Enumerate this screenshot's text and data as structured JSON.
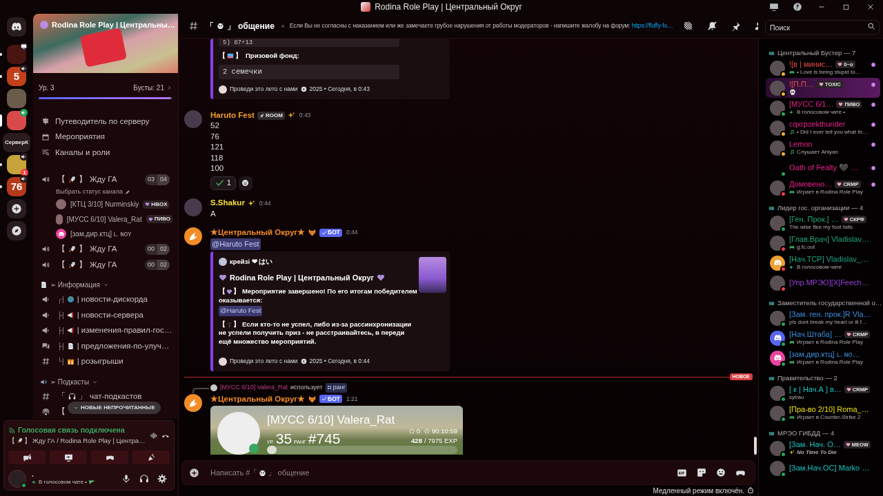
{
  "window": {
    "title": "Rodina Role Play | Центральный Округ"
  },
  "servers": [
    {
      "kind": "home",
      "selected": false,
      "unread": false
    },
    {
      "kind": "server",
      "selected": false,
      "unread": true,
      "activity": {
        "kind": "screen"
      }
    },
    {
      "kind": "server",
      "selected": false,
      "unread": true,
      "activity": {
        "kind": "speaker"
      },
      "label": "5"
    },
    {
      "kind": "server",
      "selected": false,
      "unread": false
    },
    {
      "kind": "server",
      "selected": true,
      "unread": false,
      "activity": {
        "kind": "speaker_active"
      }
    },
    {
      "kind": "server",
      "selected": false,
      "unread": false,
      "label": "СерверК"
    },
    {
      "kind": "server",
      "selected": false,
      "unread": true,
      "activity": {
        "kind": "speaker"
      },
      "mentions": "1"
    },
    {
      "kind": "server",
      "selected": false,
      "unread": true,
      "activity": {
        "kind": "speaker"
      },
      "label": "76"
    },
    {
      "kind": "add",
      "selected": false,
      "unread": false
    },
    {
      "kind": "explore",
      "selected": false,
      "unread": false
    }
  ],
  "sidebar": {
    "server_name": "Rodina Role Play | Центральны…",
    "boost": {
      "tier": "Ур. 3",
      "boosts": "Бусты: 21",
      "level": 0.99
    },
    "nav": [
      {
        "kind": "guide",
        "label": "Путеводитель по серверу"
      },
      {
        "kind": "events",
        "label": "Мероприятия"
      },
      {
        "kind": "browse",
        "label": "Каналы и роли"
      }
    ],
    "channels": [
      {
        "kind": "voice",
        "open": "【",
        "close": "】",
        "name": "Жду ГА",
        "counts": [
          "03",
          "04"
        ],
        "status": "Выбрать статус канала",
        "users": [
          {
            "name": "[КТЦ 3/10] Nurminskiy",
            "tag": "HBOX"
          },
          {
            "name": "[МУСС 6/10] Valera_Rat",
            "tag": "ПИВО"
          },
          {
            "name": "[зам.дир.ктц] ʟ. ɴᴏʏ"
          }
        ]
      },
      {
        "kind": "voice",
        "open": "【",
        "close": "】",
        "name": "Жду ГА",
        "counts": [
          "00",
          "02"
        ]
      },
      {
        "kind": "voice",
        "open": "【",
        "close": "】",
        "name": "Жду ГА",
        "counts": [
          "00",
          "02"
        ]
      },
      {
        "kind": "category",
        "name": "➢ Информация"
      },
      {
        "kind": "announcement",
        "tree": "┌|",
        "name": "| новости-дискорда"
      },
      {
        "kind": "announcement",
        "tree": "├|",
        "name": "| новости-сервера"
      },
      {
        "kind": "announcement",
        "tree": "├|",
        "name": "| изменения-правил-гос…"
      },
      {
        "kind": "forum",
        "tree": "├|",
        "name": "| предложения-по-улуч…"
      },
      {
        "kind": "text",
        "tree": "└|",
        "name": "| розыгрыши"
      },
      {
        "kind": "category",
        "name": "➢ Подкасты"
      },
      {
        "kind": "text",
        "open": "「",
        "close": "」",
        "name": "чат-подкастов"
      },
      {
        "kind": "stage",
        "open": "【"
      }
    ],
    "new_unread": "НОВЫЕ НЕПРОЧИТАННЫЕ",
    "voice_panel": {
      "status": "Голосовая связь подключена",
      "open": "【",
      "close": "】",
      "location": "Жду ГА / Rodina Role Play | Центра…"
    },
    "user": {
      "name": ".",
      "status": "В голосовом чате •"
    }
  },
  "chat": {
    "header": {
      "open": "「",
      "close": "」",
      "channel": "общение",
      "topic": "Если Вы не согласны с наказанием или же замечаете грубое нарушения от работы модераторов - напишите жалобу на форум:",
      "link": "https://fluffy-fo…"
    },
    "messages": [
      {
        "kind": "embed_tail",
        "code_top": "5) 87+13",
        "field_open": "【",
        "field_close": "】",
        "field": "Призовой фонд:",
        "code": "2 семечки",
        "footer": "Проведи это лето с нами",
        "footer_time": "2025 • Сегодня, в 0:43"
      },
      {
        "kind": "message",
        "author": "Haruto Fest",
        "color": "#f0a030",
        "tag": "ROOM",
        "time": "0:43",
        "lines": [
          "52",
          "76",
          "121",
          "118",
          "100"
        ],
        "reaction": {
          "count": "1",
          "selected": false
        }
      },
      {
        "kind": "message",
        "author": "S.Shakur",
        "color": "#f3e03b",
        "time": "0:44",
        "lines": [
          "A"
        ]
      },
      {
        "kind": "bot_embed",
        "author": "★Центральный Округ★",
        "color": "#f28c28",
        "bot": "БОТ",
        "time": "0:44",
        "mention": "@Haruto Fest",
        "embed": {
          "author": "крейзі ❤ はい",
          "title": "Rodina Role Play | Центральный Округ",
          "paragraphs": [
            {
              "open": "【",
              "close": "】",
              "text": "Мероприятие завершено! По его итогам победителем оказывается:",
              "mention": "@Haruto Fest"
            },
            {
              "open": "【",
              "close": "】",
              "text": "Если кто-то не успел, либо из-за рассинхронизации не успели получить приз - не расстраивайтесь, в переди ещё множество мероприятий."
            }
          ],
          "footer": "Проведи это лето с нами",
          "footer_time": "2025 • Сегодня, в 0:44"
        }
      },
      {
        "kind": "divider",
        "label": "НОВОЕ"
      },
      {
        "kind": "rank",
        "reply": {
          "user": "[МУСС 6/10] Valera_Rat",
          "verb": "использует",
          "command": "ранг"
        },
        "author": "★Центральный Округ★",
        "color": "#f28c28",
        "bot": "БОТ",
        "time": "1:21",
        "card": {
          "name": "[МУСС 6/10] Valera_Rat",
          "level_label": "УР.",
          "level_value": "35",
          "rank_label": "РАНГ",
          "rank": "#745",
          "coins": "0",
          "voice_time": "90:10:59",
          "xp": "428",
          "xp_total": "/ 7975 EXP",
          "level": 0.05
        }
      }
    ],
    "composer": {
      "placeholder": [
        "Написать #「",
        "」 общение"
      ]
    },
    "slow_mode": "Медленный режим включён."
  },
  "members": {
    "search": {
      "placeholder": "Поиск"
    },
    "groups": [
      {
        "title": "Центральный Бустер — 7",
        "members": [
          {
            "name": "![в | минис…",
            "color": "#ec4b4b",
            "tag": "0~o",
            "activity": {
              "kind": "game",
              "text": "•     Love is being stupid to…"
            },
            "presence": {
              "color": "#f0b232"
            },
            "avatar": {
              "kind": "photo"
            },
            "booster": true,
            "selected": false
          },
          {
            "name": "![П.П…",
            "color": "#ec4b4b",
            "tag": "TOXIC",
            "activity": {
              "kind": "skull"
            },
            "presence": {
              "color": "#f0b232"
            },
            "avatar": {
              "kind": "photo"
            },
            "booster": true,
            "selected": true
          },
          {
            "name": "[МУСС 6/1…",
            "color": "#e8208c",
            "tag": "ПИВО",
            "activity": {
              "kind": "voice",
              "text": "В голосовом чате •"
            },
            "presence": {
              "color": "#23a55a"
            },
            "avatar": {
              "kind": "photo"
            },
            "booster": true,
            "selected": false
          },
          {
            "name": "cqxrpsekthunder",
            "color": "#e8208c",
            "activity": {
              "kind": "music",
              "text": "• Did I ever tell you what th…"
            },
            "presence": {
              "color": "#f0b232"
            },
            "avatar": {
              "kind": "photo"
            },
            "booster": true,
            "selected": false
          },
          {
            "name": "Lemon",
            "color": "#e8208c",
            "activity": {
              "kind": "music",
              "text": "Слушает Ahiyan"
            },
            "presence": {
              "color": "#f0b232"
            },
            "avatar": {
              "kind": "photo"
            },
            "booster": true,
            "selected": false
          },
          {
            "name": "Oath of Fealty 🖤 …",
            "color": "#e8208c",
            "presence": {
              "color": "#23a55a"
            },
            "avatar": {
              "kind": "none"
            },
            "booster": true,
            "selected": false
          },
          {
            "name": "Домовено…",
            "color": "#e8208c",
            "tag": "CRMP",
            "activity": {
              "kind": "game",
              "text": "Играет в Rodina Role Play"
            },
            "presence": {
              "color": "#f23f43"
            },
            "avatar": {
              "kind": "photo"
            },
            "booster": true,
            "selected": false
          }
        ]
      },
      {
        "title": "Лидер гос. организации — 4",
        "members": [
          {
            "name": "[Ген. Прок.] …",
            "color": "#1fa784",
            "tag": "СКРФ",
            "activity": {
              "kind": "text",
              "text": "The wise flee my foot falls"
            },
            "presence": {
              "color": "#23a55a"
            },
            "avatar": {
              "kind": "photo"
            },
            "selected": false
          },
          {
            "name": "[Глав.Врач] Vladislav…",
            "color": "#1fa784",
            "activity": {
              "kind": "game",
              "text": "g.fc.out"
            },
            "presence": {
              "color": "#f23f43"
            },
            "avatar": {
              "kind": "photo"
            },
            "selected": false
          },
          {
            "name": "[Нач.ТСР] Vladislav_…",
            "color": "#1fa784",
            "activity": {
              "kind": "voice",
              "text": "В голосовом чате"
            },
            "presence": {
              "color": "#f23f43"
            },
            "avatar": {
              "kind": "discord",
              "color": "#f0a232"
            },
            "selected": false
          },
          {
            "name": "[Упр.МРЭО][X]Feech…",
            "color": "#9b3ddb",
            "presence": {
              "color": "#f23f43"
            },
            "avatar": {
              "kind": "photo"
            },
            "selected": false
          }
        ]
      },
      {
        "title": "Заместитель государственной о…",
        "members": [
          {
            "name": "[Зам. ген. прок.]R Vla…",
            "color": "#3d8fe0",
            "activity": {
              "kind": "text",
              "text": "pls dont break my heart or ill f…"
            },
            "presence": {
              "color": "#23a55a"
            },
            "avatar": {
              "kind": "photo"
            },
            "selected": false
          },
          {
            "name": "[Нач.Штаба] …",
            "color": "#3d8fe0",
            "tag": "CRMP",
            "activity": {
              "kind": "game",
              "text": "Играет в Rodina Role Play"
            },
            "presence": {
              "color": "#23a55a"
            },
            "avatar": {
              "kind": "discord",
              "color": "#5865f2"
            },
            "selected": false
          },
          {
            "name": "[зам.дир.ктц] ʟ. ɴᴏ…",
            "color": "#3d8fe0",
            "activity": {
              "kind": "game",
              "text": "Играет в Rodina Role Play"
            },
            "presence": {
              "color": "#23a55a"
            },
            "avatar": {
              "kind": "discord",
              "color": "#eb459e"
            },
            "selected": false
          }
        ]
      },
      {
        "title": "Правительство — 2",
        "members": [
          {
            "name": "[ к | Нач.А ] в…",
            "color": "#1cc3c3",
            "tag": "CRMP",
            "activity": {
              "kind": "text",
              "text": "sybau"
            },
            "presence": {
              "color": "#23a55a"
            },
            "avatar": {
              "kind": "photo"
            },
            "selected": false
          },
          {
            "name": "[Пра-во 2/10] Roma_…",
            "color": "#f1e40f",
            "activity": {
              "kind": "game",
              "text": "Играет в Counter-Strike 2"
            },
            "presence": {
              "color": "#23a55a"
            },
            "avatar": {
              "kind": "photo"
            },
            "selected": false
          }
        ]
      },
      {
        "title": "МРЭО ГИБДД — 4",
        "members": [
          {
            "name": "[Зам. Нач. О…",
            "color": "#1cc3c3",
            "tag": "MEOW",
            "activity": {
              "kind": "custom",
              "text": "No Time To Die"
            },
            "presence": {
              "color": "#23a55a"
            },
            "avatar": {
              "kind": "photo"
            },
            "selected": false
          },
          {
            "name": "[Зам.Нач.ОС] Marko …",
            "color": "#1cc3c3",
            "presence": {
              "color": "#23a55a"
            },
            "avatar": {
              "kind": "photo"
            },
            "selected": false
          }
        ]
      }
    ]
  }
}
